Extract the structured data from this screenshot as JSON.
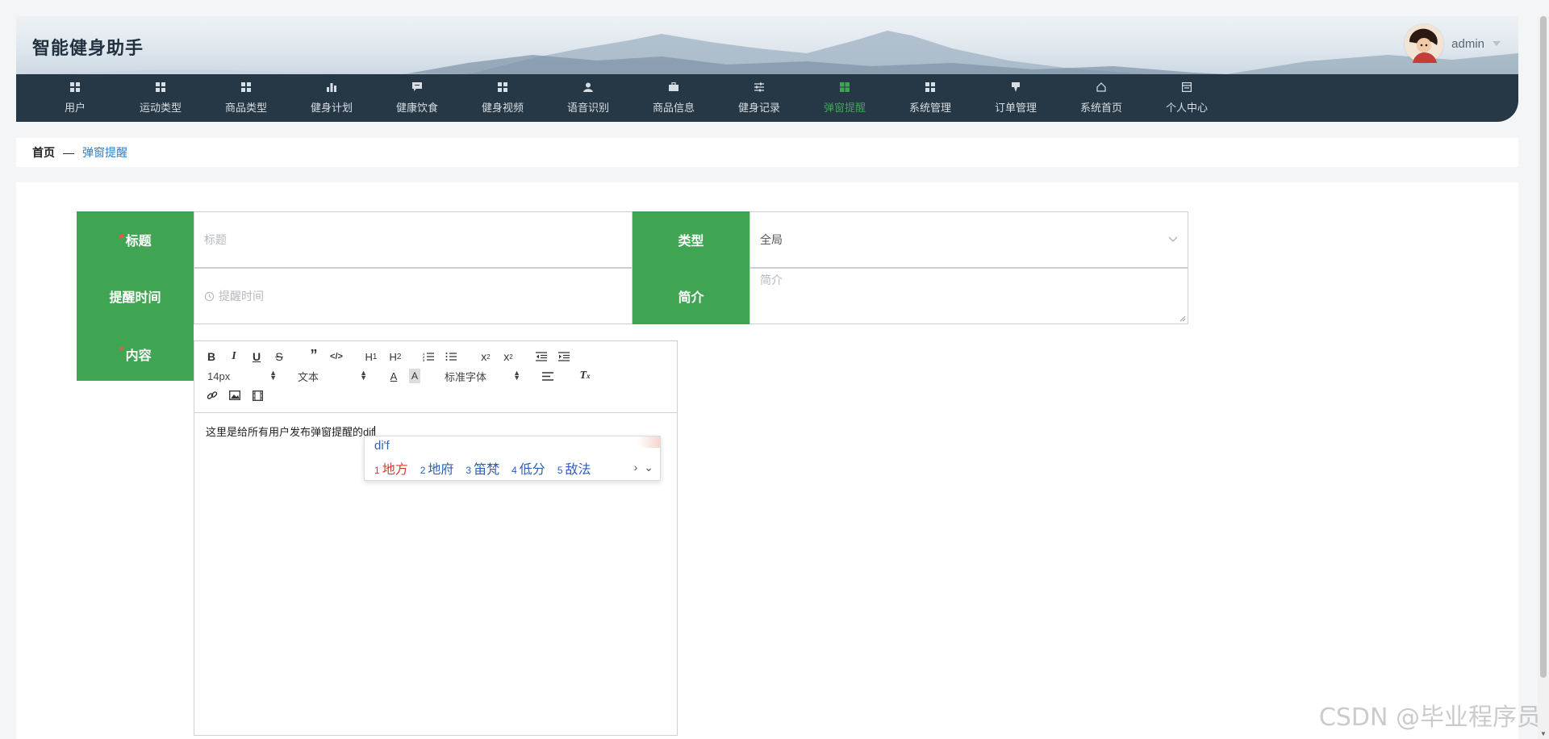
{
  "header": {
    "site_title": "智能健身助手",
    "username": "admin"
  },
  "nav": {
    "items": [
      {
        "label": "用户",
        "icon": "grid-icon"
      },
      {
        "label": "运动类型",
        "icon": "grid-icon"
      },
      {
        "label": "商品类型",
        "icon": "grid-icon"
      },
      {
        "label": "健身计划",
        "icon": "bar-chart-icon"
      },
      {
        "label": "健康饮食",
        "icon": "comment-icon"
      },
      {
        "label": "健身视频",
        "icon": "grid-icon"
      },
      {
        "label": "语音识别",
        "icon": "user-icon"
      },
      {
        "label": "商品信息",
        "icon": "briefcase-icon"
      },
      {
        "label": "健身记录",
        "icon": "sliders-icon"
      },
      {
        "label": "弹窗提醒",
        "icon": "grid-icon"
      },
      {
        "label": "系统管理",
        "icon": "grid-icon"
      },
      {
        "label": "订单管理",
        "icon": "pin-icon"
      },
      {
        "label": "系统首页",
        "icon": "home-icon"
      },
      {
        "label": "个人中心",
        "icon": "window-icon"
      }
    ],
    "active_index": 9,
    "active_color": "#3fa553"
  },
  "breadcrumb": {
    "home": "首页",
    "separator": "—",
    "current": "弹窗提醒"
  },
  "form": {
    "title_label": "标题",
    "title_placeholder": "标题",
    "type_label": "类型",
    "type_value": "全局",
    "time_label": "提醒时间",
    "time_placeholder": "提醒时间",
    "intro_label": "简介",
    "intro_placeholder": "简介",
    "content_label": "内容",
    "required_mark": "*",
    "label_color": "#3fa553"
  },
  "editor": {
    "font_size": "14px",
    "block_format": "文本",
    "font_family": "标准字体",
    "content_text": "这里是给所有用户发布弹窗提醒的dif"
  },
  "ime": {
    "input": "di'f",
    "candidates": [
      {
        "n": "1",
        "text": "地方"
      },
      {
        "n": "2",
        "text": "地府"
      },
      {
        "n": "3",
        "text": "笛梵"
      },
      {
        "n": "4",
        "text": "低分"
      },
      {
        "n": "5",
        "text": "敌法"
      }
    ]
  },
  "watermark": "CSDN @毕业程序员"
}
